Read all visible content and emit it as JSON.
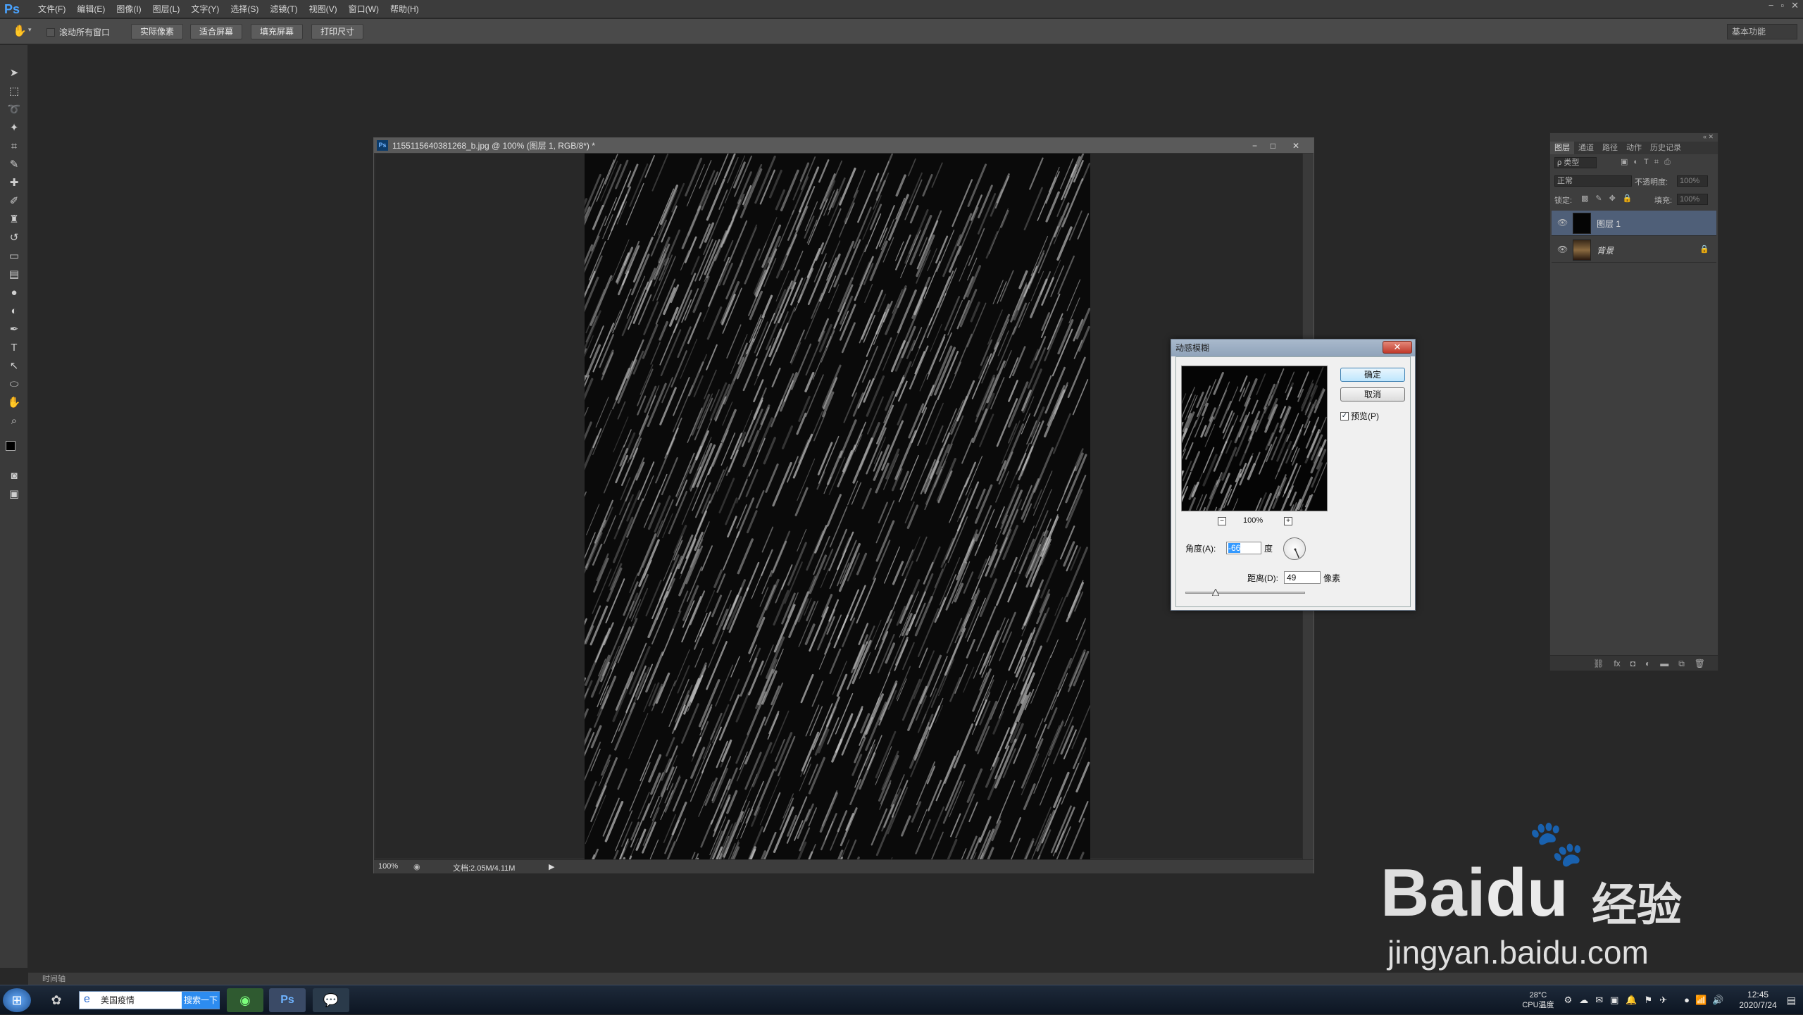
{
  "app": {
    "logo": "Ps",
    "menu": [
      "文件(F)",
      "编辑(E)",
      "图像(I)",
      "图层(L)",
      "文字(Y)",
      "选择(S)",
      "滤镜(T)",
      "视图(V)",
      "窗口(W)",
      "帮助(H)"
    ],
    "window_controls": [
      "−",
      "▫",
      "✕"
    ]
  },
  "options_bar": {
    "scroll_all_label": "滚动所有窗口",
    "buttons": [
      "实际像素",
      "适合屏幕",
      "填充屏幕",
      "打印尺寸"
    ],
    "workspace": "基本功能"
  },
  "document": {
    "title": "1155115640381268_b.jpg @ 100% (图层 1, RGB/8*) *",
    "zoom": "100%",
    "doc_size": "文档:2.05M/4.11M",
    "controls": [
      "−",
      "□",
      "✕"
    ]
  },
  "dialog": {
    "title": "动感模糊",
    "close": "✕",
    "ok": "确定",
    "cancel": "取消",
    "preview_label": "预览(P)",
    "preview_checked": true,
    "zoom": "100%",
    "zoom_minus": "−",
    "zoom_plus": "+",
    "angle_label": "角度(A):",
    "angle_value": "-66",
    "angle_unit": "度",
    "distance_label": "距离(D):",
    "distance_value": "49",
    "distance_unit": "像素",
    "slider_fraction": 0.25
  },
  "layers_panel": {
    "tabs": [
      "图层",
      "通道",
      "路径",
      "动作",
      "历史记录"
    ],
    "filter": "ρ 类型",
    "blend_mode": "正常",
    "opacity_label": "不透明度:",
    "opacity": "100%",
    "lock_label": "锁定:",
    "fill_label": "填充:",
    "fill": "100%",
    "layers": [
      {
        "name": "图层 1",
        "selected": true
      },
      {
        "name": "背景",
        "selected": false,
        "locked": true
      }
    ]
  },
  "timeline_label": "时间轴",
  "taskbar": {
    "search_text": "美国疫情",
    "search_button": "搜索一下",
    "temp": "28°C",
    "temp_label": "CPU温度",
    "time": "12:45",
    "date": "2020/7/24"
  },
  "watermark": {
    "brand": "Bai",
    "brand2": "du",
    "cn": "经验",
    "url": "jingyan.baidu.com"
  }
}
